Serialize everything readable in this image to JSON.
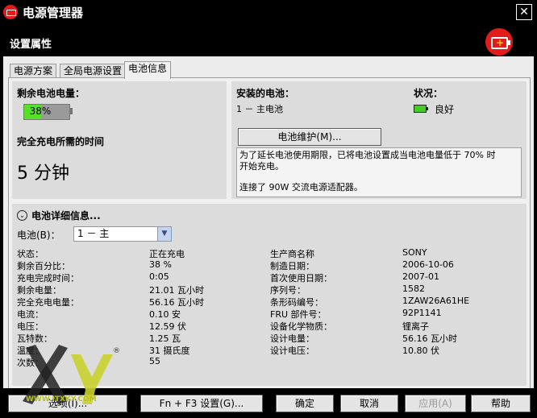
{
  "window": {
    "title": "电源管理器",
    "close_glyph": "✕"
  },
  "header": {
    "title": "设置属性"
  },
  "tabs": [
    {
      "label": "电源方案"
    },
    {
      "label": "全局电源设置"
    },
    {
      "label": "电池信息"
    }
  ],
  "remaining": {
    "heading": "剩余电池电量：",
    "percent_text": "38%",
    "percent_value": 38,
    "charge_time_label": "完全充电所需的时间",
    "charge_time_value": "5",
    "charge_time_unit": "分钟"
  },
  "installed": {
    "heading": "安装的电池：",
    "battery": "1 － 主电池",
    "status_heading": "状况：",
    "status_value": "良好",
    "maintenance_button": "电池维护(M)...",
    "info_line1": "为了延长电池使用期限，已将电池设置成当电池电量低于 70% 时",
    "info_line2": "开始充电。",
    "info_line3": "连接了 90W 交流电源适配器。"
  },
  "details": {
    "heading": "电池详细信息...",
    "battery_label": "电池(B)：",
    "battery_select": "1 － 主",
    "left": [
      {
        "label": "状态：",
        "value": "正在充电"
      },
      {
        "label": "剩余百分比：",
        "value": "38 %"
      },
      {
        "label": "充电完成时间：",
        "value": "0:05"
      },
      {
        "label": "剩余电量：",
        "value": "21.01 瓦小时"
      },
      {
        "label": "完全充电电量：",
        "value": "56.16 瓦小时"
      },
      {
        "label": "电流：",
        "value": "0.10 安"
      },
      {
        "label": "电压：",
        "value": "12.59 伏"
      },
      {
        "label": "瓦特数：",
        "value": "1.25 瓦"
      },
      {
        "label": "温度：",
        "value": "31 摄氏度"
      },
      {
        "label": "次数：",
        "value": "55"
      }
    ],
    "right": [
      {
        "label": "生产商名称",
        "value": "SONY"
      },
      {
        "label": "制造日期：",
        "value": "2006-10-06"
      },
      {
        "label": "首次使用日期：",
        "value": "2007-01"
      },
      {
        "label": "序列号：",
        "value": "1582"
      },
      {
        "label": "条形码编号：",
        "value": "1ZAW26A61HE"
      },
      {
        "label": "FRU 部件号：",
        "value": "92P1141"
      },
      {
        "label": "设备化学物质：",
        "value": "锂离子"
      },
      {
        "label": "设计电量：",
        "value": "56.16 瓦小时"
      },
      {
        "label": "设计电压：",
        "value": "10.80 伏"
      }
    ]
  },
  "buttons": {
    "options": "选项(I)...",
    "fn_f3": "Fn + F3 设置(G)...",
    "ok": "确定",
    "cancel": "取消",
    "apply": "应用(A)",
    "help": "帮助"
  },
  "watermark": {
    "brand": "XY",
    "url": "WWW.ITXKY.COM"
  }
}
